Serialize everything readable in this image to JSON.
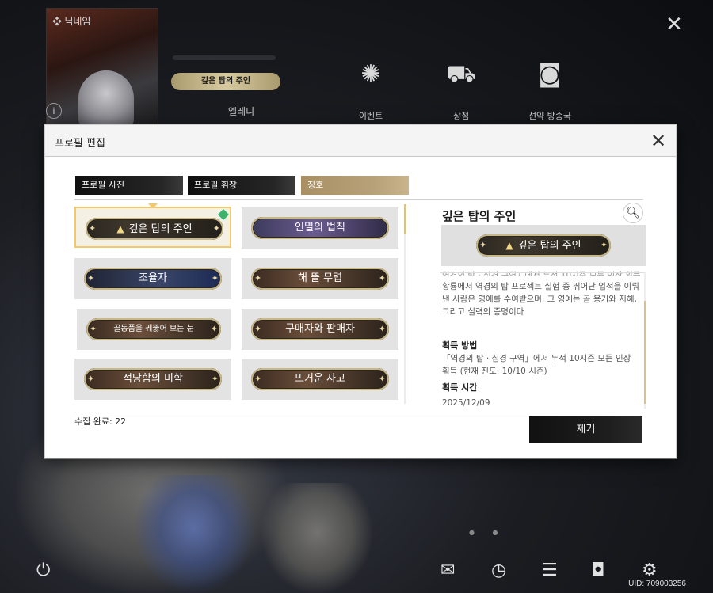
{
  "background": {
    "nickname_label": "닉네임",
    "title_badge": "깊은 탑의 주인",
    "player_name": "엘레니",
    "info_icon": "i",
    "menu": [
      {
        "label": "이벤트",
        "icon": "event-icon"
      },
      {
        "label": "상점",
        "icon": "cart-icon"
      },
      {
        "label": "선약 방송국",
        "icon": "broadcast-icon"
      }
    ],
    "uid": "UID: 709003256"
  },
  "dialog": {
    "title": "프로필 편집",
    "tabs": [
      {
        "label": "프로필 사진",
        "active": false
      },
      {
        "label": "프로필 휘장",
        "active": false
      },
      {
        "label": "칭호",
        "active": true
      }
    ],
    "titles": [
      {
        "label": "깊은 탑의 주인",
        "selected": true,
        "equipped": true
      },
      {
        "label": "인멸의 법칙",
        "selected": false,
        "equipped": false
      },
      {
        "label": "조율자",
        "selected": false,
        "equipped": false
      },
      {
        "label": "해 뜰 무렵",
        "selected": false,
        "equipped": false
      },
      {
        "label": "골동품을 꿰뚫어 보는 눈",
        "selected": false,
        "equipped": false
      },
      {
        "label": "구매자와 판매자",
        "selected": false,
        "equipped": false
      },
      {
        "label": "적당함의 미학",
        "selected": false,
        "equipped": false
      },
      {
        "label": "뜨거운 사고",
        "selected": false,
        "equipped": false
      }
    ],
    "detail": {
      "title": "깊은 탑의 주인",
      "preview_label": "깊은 탑의 주인",
      "description_cut": "역경의 탑 · 심경 구역」에서 누적 10시즌 모든 인장 획득",
      "description": "황룡에서 역경의 탑 프로젝트 실험 중 뛰어난 업적을 이뤄낸 사람은 영예를 수여받으며, 그 영예는 곧 용기와 지혜, 그리고 실력의 증명이다",
      "method_heading": "획득 방법",
      "method_text": "「역경의 탑 · 심경 구역」에서 누적 10시즌 모든 인장 획득 (현재 진도: 10/10 시즌)",
      "time_heading": "획득 시간",
      "time_text": "2025/12/09"
    },
    "collect_count": "수집 완료: 22",
    "remove_label": "제거"
  },
  "colors": {
    "accent_gold": "#b8a27a",
    "selected_border": "#f2c96a",
    "equipped_green": "#3db36b"
  }
}
